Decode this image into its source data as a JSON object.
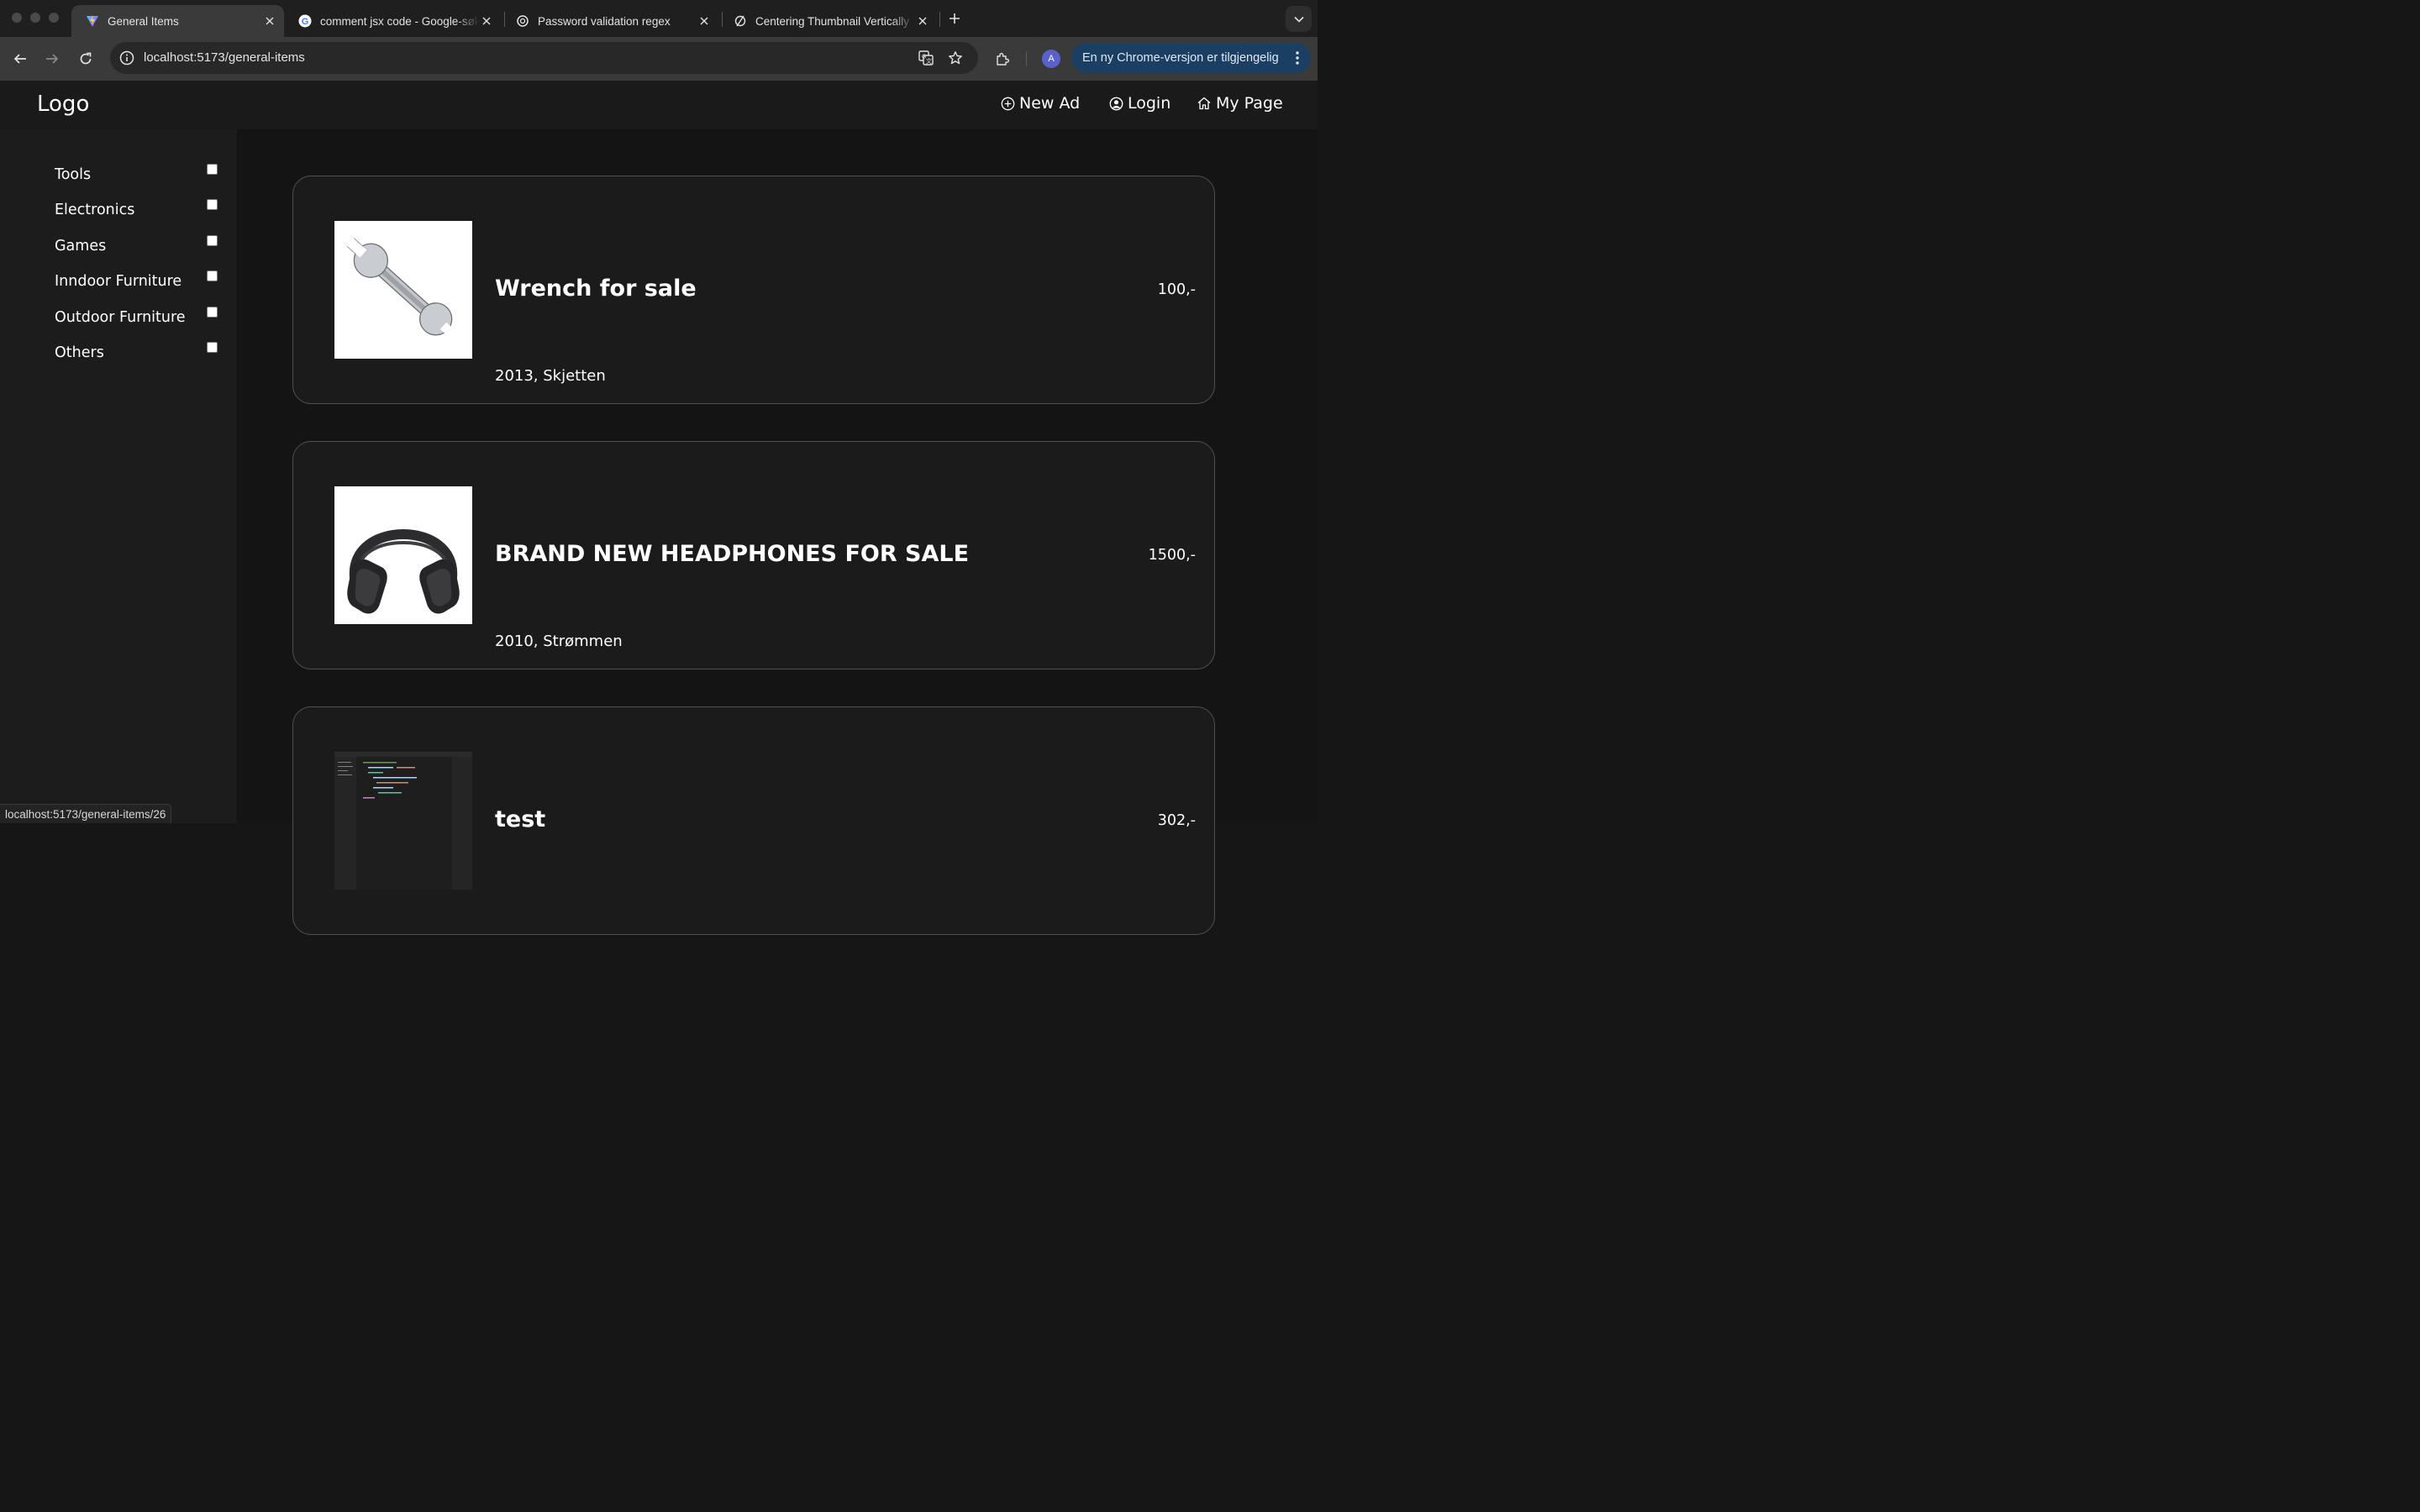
{
  "browser": {
    "tabs": [
      {
        "title": "General Items",
        "favicon": "vite-icon",
        "active": true
      },
      {
        "title": "comment jsx code - Google-søk",
        "favicon": "google-icon",
        "active": false
      },
      {
        "title": "Password validation regex",
        "favicon": "openai-icon",
        "active": false
      },
      {
        "title": "Centering Thumbnail Vertically",
        "favicon": "perplexity-icon",
        "active": false
      }
    ],
    "url": "localhost:5173/general-items",
    "update_label": "En ny Chrome-versjon er tilgjengelig",
    "profile_initial": "A",
    "status_url": "localhost:5173/general-items/26"
  },
  "header": {
    "logo": "Logo",
    "nav": {
      "new_ad": "New Ad",
      "login": "Login",
      "my_page": "My Page"
    }
  },
  "sidebar": {
    "categories": [
      {
        "label": "Tools",
        "checked": false
      },
      {
        "label": "Electronics",
        "checked": false
      },
      {
        "label": "Games",
        "checked": false
      },
      {
        "label": "Inndoor Furniture",
        "checked": false
      },
      {
        "label": "Outdoor Furniture",
        "checked": false
      },
      {
        "label": "Others",
        "checked": false
      }
    ]
  },
  "items": [
    {
      "title": "Wrench for sale",
      "price": "100,-",
      "meta": "2013, Skjetten",
      "thumb": "wrench-image"
    },
    {
      "title": "BRAND NEW HEADPHONES FOR SALE",
      "price": "1500,-",
      "meta": "2010, Strømmen",
      "thumb": "headphones-image"
    },
    {
      "title": "test",
      "price": "302,-",
      "meta": "",
      "thumb": "code-screenshot-image"
    }
  ],
  "colors": {
    "page_bg": "#141414",
    "sidebar_bg": "#1c1c1c",
    "card_bg": "#1b1b1b",
    "card_border": "#505050",
    "update_pill": "#1b3e63"
  }
}
